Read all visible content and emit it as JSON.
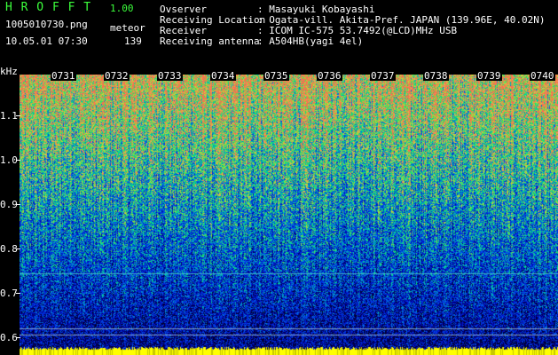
{
  "app": {
    "title": "H R O F F T",
    "version": "1.00",
    "filename": "1005010730.png",
    "datetime": "10.05.01 07:30",
    "mode": "meteor",
    "count": "139"
  },
  "info": [
    {
      "label": "Ovserver",
      "value": ": Masayuki Kobayashi"
    },
    {
      "label": "Receiving Location",
      "value": ": Ogata-vill. Akita-Pref. JAPAN (139.96E, 40.02N)"
    },
    {
      "label": "Receiver",
      "value": ": ICOM IC-575 53.7492(@LCD)MHz USB"
    },
    {
      "label": "Receiving antenna",
      "value": ": A504HB(yagi 4el)"
    }
  ],
  "axis": {
    "unit": "kHz",
    "yticks": [
      "1.1",
      "1.0",
      "0.9",
      "0.8",
      "0.7",
      "0.6"
    ],
    "time_labels": [
      "0731",
      "0732",
      "0733",
      "0734",
      "0735",
      "0736",
      "0737",
      "0738",
      "0739",
      "0740"
    ]
  },
  "colors": {
    "title": "#3cff3c",
    "text": "#ffffff",
    "baseline": "#ffff00",
    "marker_line": "#3cb4c8"
  }
}
